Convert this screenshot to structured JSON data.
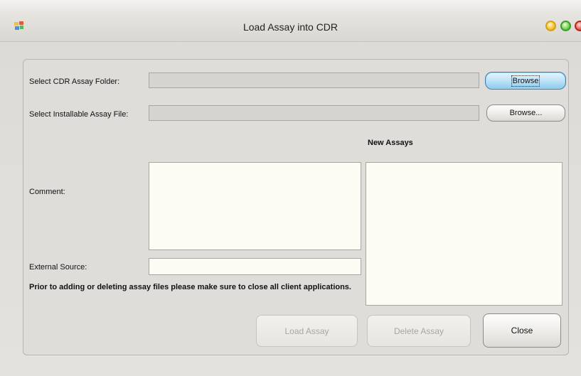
{
  "window": {
    "title": "Load Assay into CDR"
  },
  "form": {
    "cdr_folder_label": "Select CDR Assay Folder:",
    "cdr_folder_value": "",
    "installable_file_label": "Select Installable Assay File:",
    "installable_file_value": "",
    "browse_label_1": "Browse",
    "browse_label_2": "Browse...",
    "new_assays_label": "New Assays",
    "comment_label": "Comment:",
    "comment_value": "",
    "external_source_label": "External Source:",
    "external_source_value": "",
    "warning_text": "Prior to adding or deleting assay files please make sure to close all client applications."
  },
  "buttons": {
    "load_assay": "Load Assay",
    "delete_assay": "Delete Assay",
    "close": "Close"
  },
  "colors": {
    "accent_focus": "#8ccbee",
    "title_minimize": "#f5c842",
    "title_maximize": "#7fd75b",
    "title_close": "#ef6a5c"
  }
}
